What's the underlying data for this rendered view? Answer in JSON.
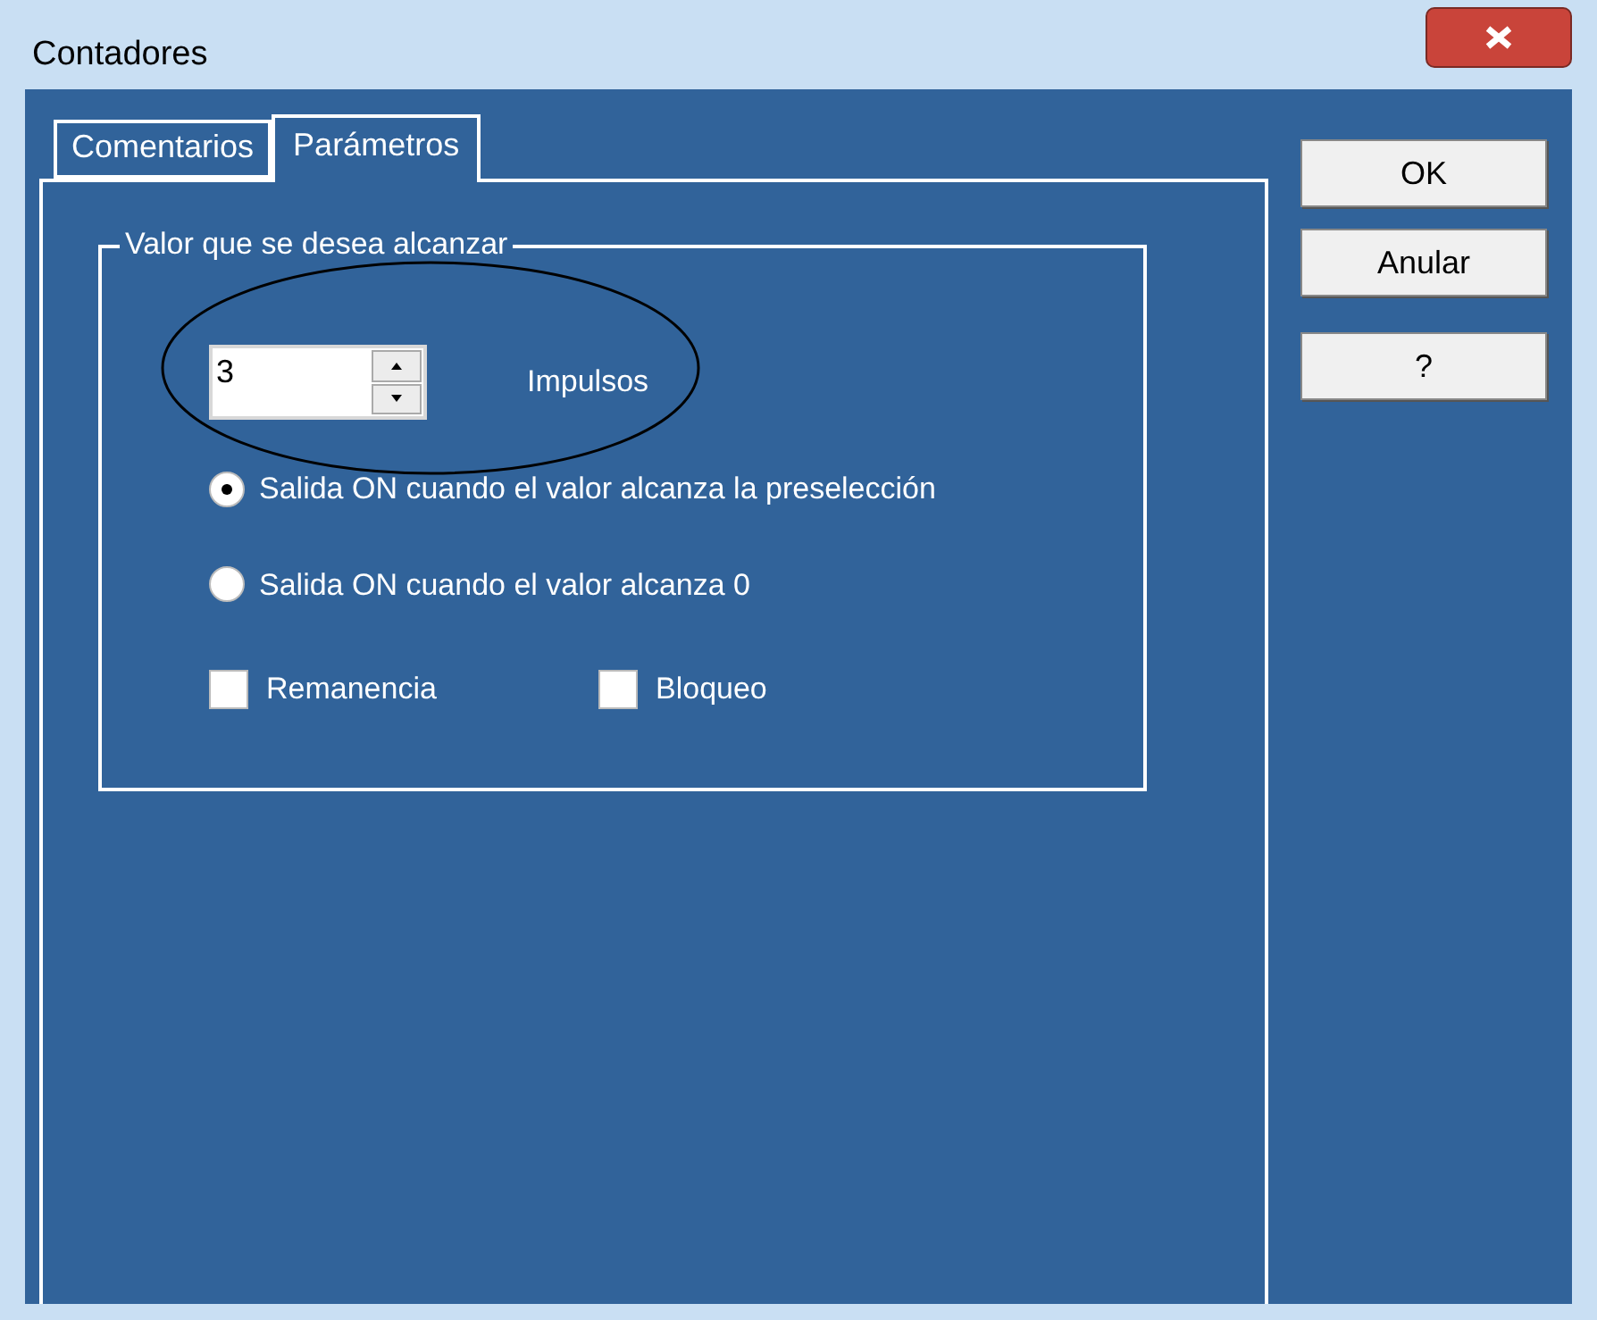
{
  "window": {
    "title": "Contadores"
  },
  "tabs": [
    {
      "label": "Comentarios",
      "selected": false
    },
    {
      "label": "Parámetros",
      "selected": true
    }
  ],
  "group": {
    "title": "Valor que se desea alcanzar",
    "spinner": {
      "value": "3",
      "unit": "Impulsos"
    },
    "options": [
      {
        "label": "Salida ON cuando el valor alcanza la preselección",
        "selected": true
      },
      {
        "label": "Salida ON cuando el valor alcanza 0",
        "selected": false
      }
    ],
    "checkboxes": [
      {
        "label": "Remanencia",
        "checked": false
      },
      {
        "label": "Bloqueo",
        "checked": false
      }
    ]
  },
  "buttons": [
    "OK",
    "Anular",
    "?"
  ]
}
